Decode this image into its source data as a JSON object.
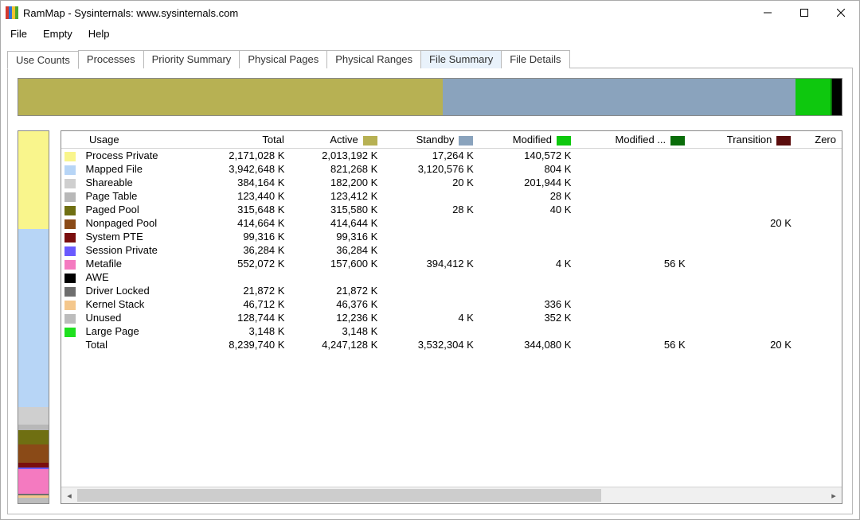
{
  "window": {
    "title": "RamMap - Sysinternals: www.sysinternals.com"
  },
  "menus": [
    "File",
    "Empty",
    "Help"
  ],
  "tabs": [
    "Use Counts",
    "Processes",
    "Priority Summary",
    "Physical Pages",
    "Physical Ranges",
    "File Summary",
    "File Details"
  ],
  "active_tab": 0,
  "columns": [
    {
      "label": "Usage",
      "align": "left"
    },
    {
      "label": "Total",
      "align": "right"
    },
    {
      "label": "Active",
      "align": "right",
      "swatch": "#b7b153"
    },
    {
      "label": "Standby",
      "align": "right",
      "swatch": "#8aa3bd"
    },
    {
      "label": "Modified",
      "align": "right",
      "swatch": "#0ec80e"
    },
    {
      "label": "Modified ...",
      "align": "right",
      "swatch": "#0a6d0a"
    },
    {
      "label": "Transition",
      "align": "right",
      "swatch": "#5a0c0c"
    },
    {
      "label": "Zero",
      "align": "right"
    }
  ],
  "rows": [
    {
      "swatch": "#f9f58c",
      "name": "Process Private",
      "total": "2,171,028 K",
      "active": "2,013,192 K",
      "standby": "17,264 K",
      "modified": "140,572 K",
      "modifiednw": "",
      "transition": "",
      "zero": ""
    },
    {
      "swatch": "#b7d5f6",
      "name": "Mapped File",
      "total": "3,942,648 K",
      "active": "821,268 K",
      "standby": "3,120,576 K",
      "modified": "804 K",
      "modifiednw": "",
      "transition": "",
      "zero": ""
    },
    {
      "swatch": "#cfcfcf",
      "name": "Shareable",
      "total": "384,164 K",
      "active": "182,200 K",
      "standby": "20 K",
      "modified": "201,944 K",
      "modifiednw": "",
      "transition": "",
      "zero": ""
    },
    {
      "swatch": "#b8b8b8",
      "name": "Page Table",
      "total": "123,440 K",
      "active": "123,412 K",
      "standby": "",
      "modified": "28 K",
      "modifiednw": "",
      "transition": "",
      "zero": ""
    },
    {
      "swatch": "#6f6f12",
      "name": "Paged Pool",
      "total": "315,648 K",
      "active": "315,580 K",
      "standby": "28 K",
      "modified": "40 K",
      "modifiednw": "",
      "transition": "",
      "zero": ""
    },
    {
      "swatch": "#8a4a17",
      "name": "Nonpaged Pool",
      "total": "414,664 K",
      "active": "414,644 K",
      "standby": "",
      "modified": "",
      "modifiednw": "",
      "transition": "20 K",
      "zero": ""
    },
    {
      "swatch": "#7a0e0e",
      "name": "System PTE",
      "total": "99,316 K",
      "active": "99,316 K",
      "standby": "",
      "modified": "",
      "modifiednw": "",
      "transition": "",
      "zero": ""
    },
    {
      "swatch": "#6a5aff",
      "name": "Session Private",
      "total": "36,284 K",
      "active": "36,284 K",
      "standby": "",
      "modified": "",
      "modifiednw": "",
      "transition": "",
      "zero": ""
    },
    {
      "swatch": "#f47ac0",
      "name": "Metafile",
      "total": "552,072 K",
      "active": "157,600 K",
      "standby": "394,412 K",
      "modified": "4 K",
      "modifiednw": "56 K",
      "transition": "",
      "zero": ""
    },
    {
      "swatch": "#000000",
      "name": "AWE",
      "total": "",
      "active": "",
      "standby": "",
      "modified": "",
      "modifiednw": "",
      "transition": "",
      "zero": ""
    },
    {
      "swatch": "#6e6e6e",
      "name": "Driver Locked",
      "total": "21,872 K",
      "active": "21,872 K",
      "standby": "",
      "modified": "",
      "modifiednw": "",
      "transition": "",
      "zero": ""
    },
    {
      "swatch": "#f4c78c",
      "name": "Kernel Stack",
      "total": "46,712 K",
      "active": "46,376 K",
      "standby": "",
      "modified": "336 K",
      "modifiednw": "",
      "transition": "",
      "zero": ""
    },
    {
      "swatch": "#bcbcbc",
      "name": "Unused",
      "total": "128,744 K",
      "active": "12,236 K",
      "standby": "4 K",
      "modified": "352 K",
      "modifiednw": "",
      "transition": "",
      "zero": ""
    },
    {
      "swatch": "#1fe01f",
      "name": "Large Page",
      "total": "3,148 K",
      "active": "3,148 K",
      "standby": "",
      "modified": "",
      "modifiednw": "",
      "transition": "",
      "zero": ""
    }
  ],
  "total_row": {
    "name": "Total",
    "total": "8,239,740 K",
    "active": "4,247,128 K",
    "standby": "3,532,304 K",
    "modified": "344,080 K",
    "modifiednw": "56 K",
    "transition": "20 K",
    "zero": ""
  },
  "hbar": [
    {
      "color": "#b7b153",
      "flex": 51.5
    },
    {
      "color": "#8aa3bd",
      "flex": 42.9
    },
    {
      "color": "#0ec80e",
      "flex": 4.2
    },
    {
      "color": "#0a6d0a",
      "flex": 0.2
    },
    {
      "color": "#000000",
      "flex": 1.2
    }
  ],
  "vbar": [
    {
      "color": "#f9f58c",
      "flex": 26.3
    },
    {
      "color": "#b7d5f6",
      "flex": 47.8
    },
    {
      "color": "#cfcfcf",
      "flex": 4.7
    },
    {
      "color": "#b8b8b8",
      "flex": 1.5
    },
    {
      "color": "#6f6f12",
      "flex": 3.8
    },
    {
      "color": "#8a4a17",
      "flex": 5.0
    },
    {
      "color": "#7a0e0e",
      "flex": 1.2
    },
    {
      "color": "#6a5aff",
      "flex": 0.4
    },
    {
      "color": "#f47ac0",
      "flex": 6.7
    },
    {
      "color": "#6e6e6e",
      "flex": 0.3
    },
    {
      "color": "#f4c78c",
      "flex": 0.6
    },
    {
      "color": "#bcbcbc",
      "flex": 1.6
    }
  ],
  "chart_data": {
    "type": "table",
    "title": "Use Counts",
    "columns": [
      "Usage",
      "Total",
      "Active",
      "Standby",
      "Modified",
      "Modified No-Write",
      "Transition",
      "Zero"
    ],
    "series": [
      {
        "name": "Process Private",
        "values": [
          2171028,
          2013192,
          17264,
          140572,
          null,
          null,
          null
        ]
      },
      {
        "name": "Mapped File",
        "values": [
          3942648,
          821268,
          3120576,
          804,
          null,
          null,
          null
        ]
      },
      {
        "name": "Shareable",
        "values": [
          384164,
          182200,
          20,
          201944,
          null,
          null,
          null
        ]
      },
      {
        "name": "Page Table",
        "values": [
          123440,
          123412,
          null,
          28,
          null,
          null,
          null
        ]
      },
      {
        "name": "Paged Pool",
        "values": [
          315648,
          315580,
          28,
          40,
          null,
          null,
          null
        ]
      },
      {
        "name": "Nonpaged Pool",
        "values": [
          414664,
          414644,
          null,
          null,
          null,
          20,
          null
        ]
      },
      {
        "name": "System PTE",
        "values": [
          99316,
          99316,
          null,
          null,
          null,
          null,
          null
        ]
      },
      {
        "name": "Session Private",
        "values": [
          36284,
          36284,
          null,
          null,
          null,
          null,
          null
        ]
      },
      {
        "name": "Metafile",
        "values": [
          552072,
          157600,
          394412,
          4,
          56,
          null,
          null
        ]
      },
      {
        "name": "AWE",
        "values": [
          null,
          null,
          null,
          null,
          null,
          null,
          null
        ]
      },
      {
        "name": "Driver Locked",
        "values": [
          21872,
          21872,
          null,
          null,
          null,
          null,
          null
        ]
      },
      {
        "name": "Kernel Stack",
        "values": [
          46712,
          46376,
          null,
          336,
          null,
          null,
          null
        ]
      },
      {
        "name": "Unused",
        "values": [
          128744,
          12236,
          4,
          352,
          null,
          null,
          null
        ]
      },
      {
        "name": "Large Page",
        "values": [
          3148,
          3148,
          null,
          null,
          null,
          null,
          null
        ]
      }
    ],
    "totals": [
      8239740,
      4247128,
      3532304,
      344080,
      56,
      20,
      null
    ],
    "unit": "K"
  }
}
